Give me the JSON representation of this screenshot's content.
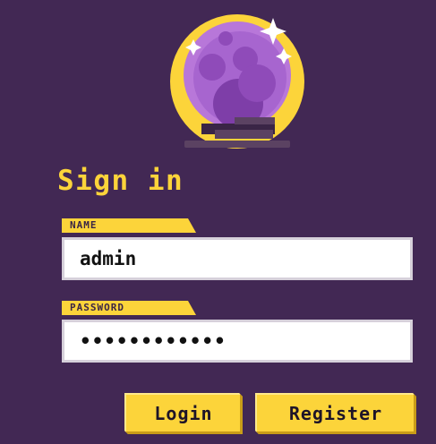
{
  "icons": {
    "logo": "crystal-ball-icon"
  },
  "colors": {
    "background": "#422854",
    "accent": "#fcd43a",
    "orb": "#b877d9",
    "input_background": "#ffffff"
  },
  "form": {
    "title": "Sign in",
    "name_label": "NAME",
    "name_value": "admin",
    "password_label": "PASSWORD",
    "password_value": "••••••••••••"
  },
  "buttons": {
    "login_label": "Login",
    "register_label": "Register"
  }
}
